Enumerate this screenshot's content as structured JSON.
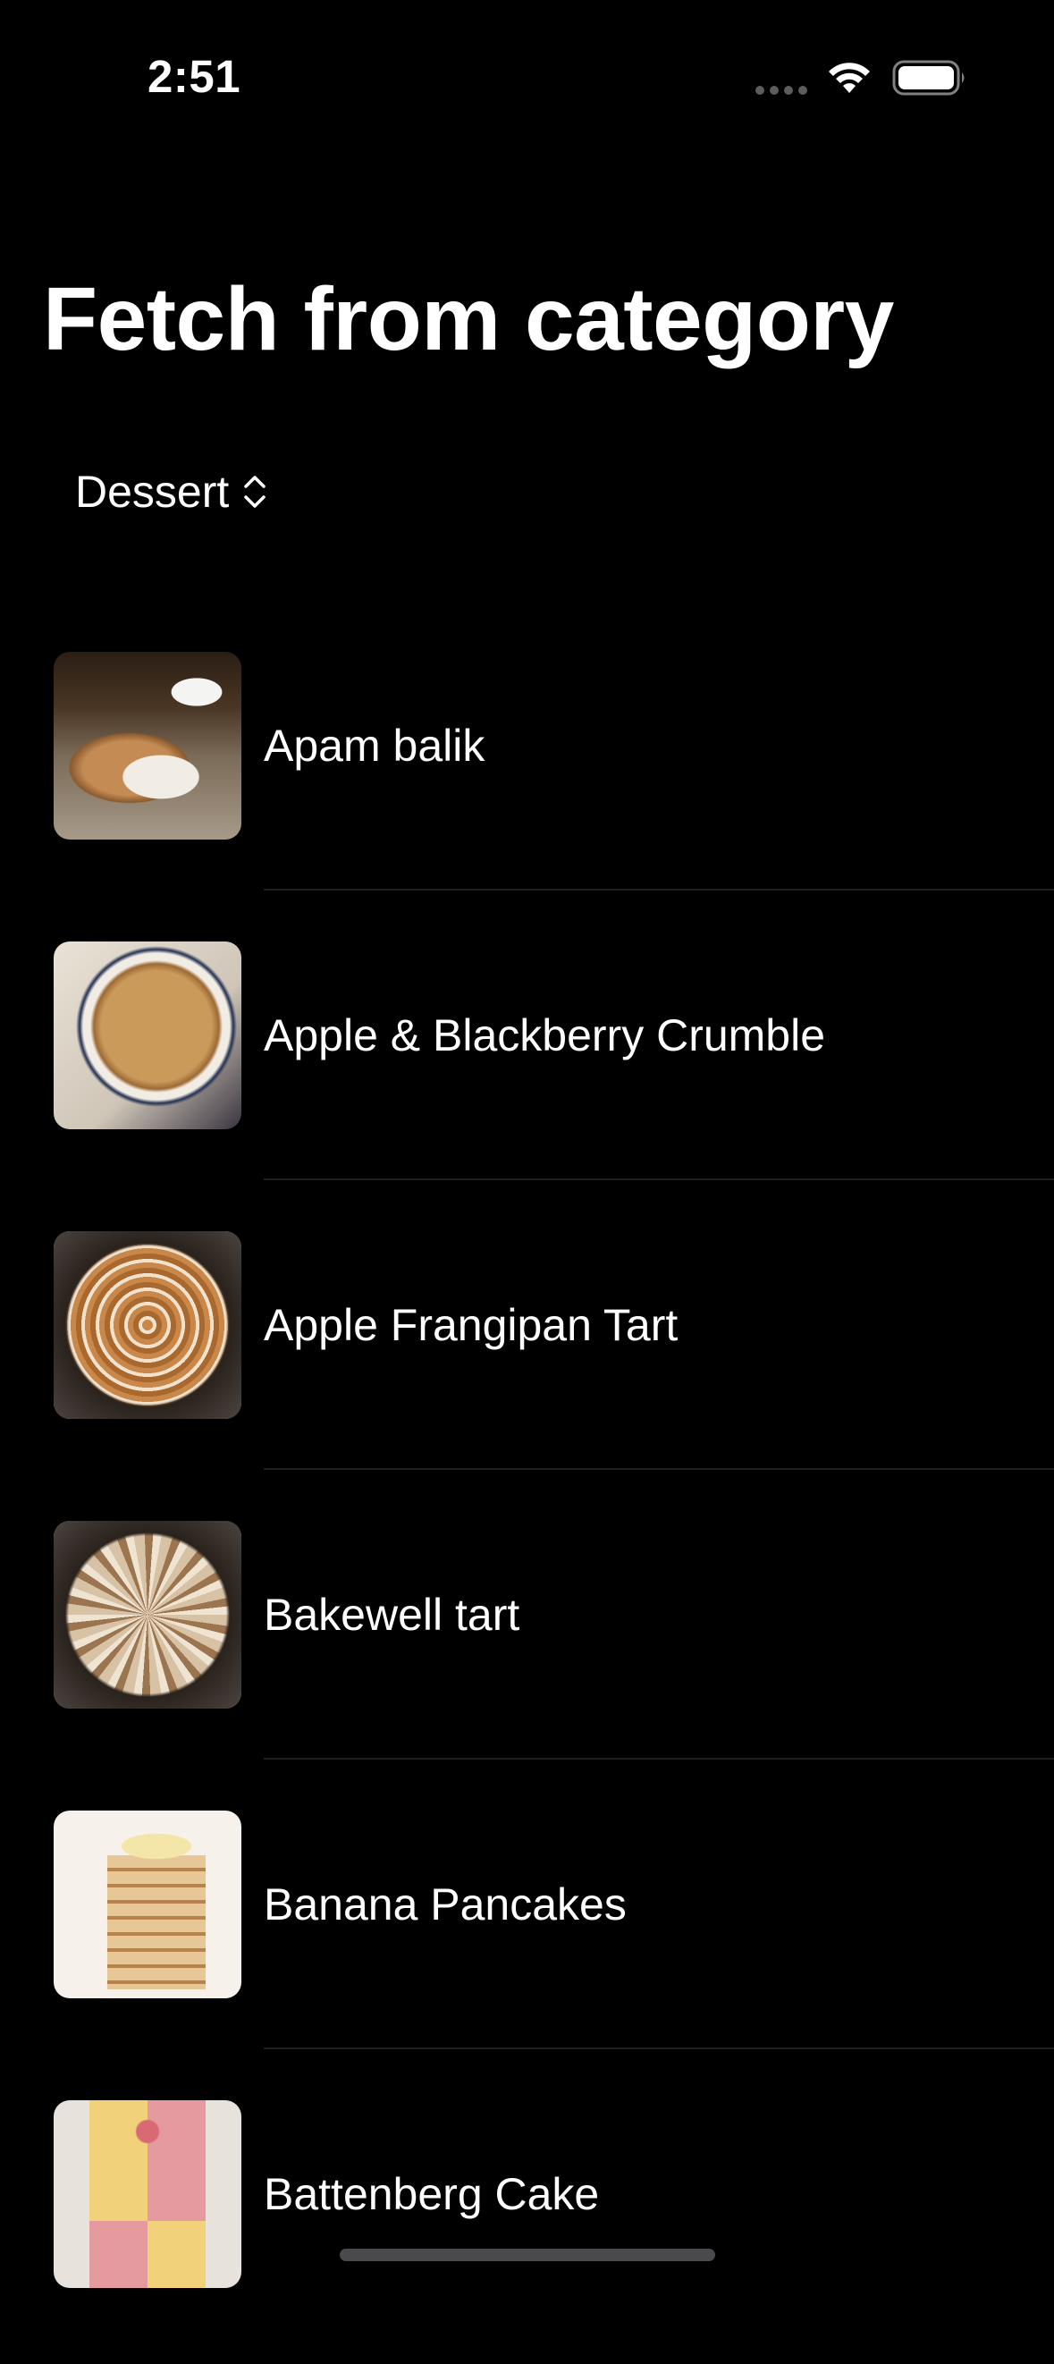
{
  "status_bar": {
    "time": "2:51"
  },
  "page": {
    "title": "Fetch from category"
  },
  "category_picker": {
    "selected": "Dessert"
  },
  "recipes": [
    {
      "name": "Apam balik"
    },
    {
      "name": "Apple & Blackberry Crumble"
    },
    {
      "name": "Apple Frangipan Tart"
    },
    {
      "name": "Bakewell tart"
    },
    {
      "name": "Banana Pancakes"
    },
    {
      "name": "Battenberg Cake"
    }
  ]
}
